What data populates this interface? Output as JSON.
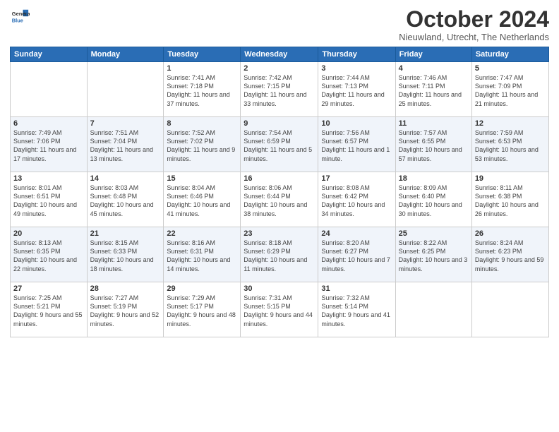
{
  "header": {
    "logo_general": "General",
    "logo_blue": "Blue",
    "title": "October 2024",
    "location": "Nieuwland, Utrecht, The Netherlands"
  },
  "days_of_week": [
    "Sunday",
    "Monday",
    "Tuesday",
    "Wednesday",
    "Thursday",
    "Friday",
    "Saturday"
  ],
  "weeks": [
    [
      {
        "day": "",
        "info": ""
      },
      {
        "day": "",
        "info": ""
      },
      {
        "day": "1",
        "info": "Sunrise: 7:41 AM\nSunset: 7:18 PM\nDaylight: 11 hours and 37 minutes."
      },
      {
        "day": "2",
        "info": "Sunrise: 7:42 AM\nSunset: 7:15 PM\nDaylight: 11 hours and 33 minutes."
      },
      {
        "day": "3",
        "info": "Sunrise: 7:44 AM\nSunset: 7:13 PM\nDaylight: 11 hours and 29 minutes."
      },
      {
        "day": "4",
        "info": "Sunrise: 7:46 AM\nSunset: 7:11 PM\nDaylight: 11 hours and 25 minutes."
      },
      {
        "day": "5",
        "info": "Sunrise: 7:47 AM\nSunset: 7:09 PM\nDaylight: 11 hours and 21 minutes."
      }
    ],
    [
      {
        "day": "6",
        "info": "Sunrise: 7:49 AM\nSunset: 7:06 PM\nDaylight: 11 hours and 17 minutes."
      },
      {
        "day": "7",
        "info": "Sunrise: 7:51 AM\nSunset: 7:04 PM\nDaylight: 11 hours and 13 minutes."
      },
      {
        "day": "8",
        "info": "Sunrise: 7:52 AM\nSunset: 7:02 PM\nDaylight: 11 hours and 9 minutes."
      },
      {
        "day": "9",
        "info": "Sunrise: 7:54 AM\nSunset: 6:59 PM\nDaylight: 11 hours and 5 minutes."
      },
      {
        "day": "10",
        "info": "Sunrise: 7:56 AM\nSunset: 6:57 PM\nDaylight: 11 hours and 1 minute."
      },
      {
        "day": "11",
        "info": "Sunrise: 7:57 AM\nSunset: 6:55 PM\nDaylight: 10 hours and 57 minutes."
      },
      {
        "day": "12",
        "info": "Sunrise: 7:59 AM\nSunset: 6:53 PM\nDaylight: 10 hours and 53 minutes."
      }
    ],
    [
      {
        "day": "13",
        "info": "Sunrise: 8:01 AM\nSunset: 6:51 PM\nDaylight: 10 hours and 49 minutes."
      },
      {
        "day": "14",
        "info": "Sunrise: 8:03 AM\nSunset: 6:48 PM\nDaylight: 10 hours and 45 minutes."
      },
      {
        "day": "15",
        "info": "Sunrise: 8:04 AM\nSunset: 6:46 PM\nDaylight: 10 hours and 41 minutes."
      },
      {
        "day": "16",
        "info": "Sunrise: 8:06 AM\nSunset: 6:44 PM\nDaylight: 10 hours and 38 minutes."
      },
      {
        "day": "17",
        "info": "Sunrise: 8:08 AM\nSunset: 6:42 PM\nDaylight: 10 hours and 34 minutes."
      },
      {
        "day": "18",
        "info": "Sunrise: 8:09 AM\nSunset: 6:40 PM\nDaylight: 10 hours and 30 minutes."
      },
      {
        "day": "19",
        "info": "Sunrise: 8:11 AM\nSunset: 6:38 PM\nDaylight: 10 hours and 26 minutes."
      }
    ],
    [
      {
        "day": "20",
        "info": "Sunrise: 8:13 AM\nSunset: 6:35 PM\nDaylight: 10 hours and 22 minutes."
      },
      {
        "day": "21",
        "info": "Sunrise: 8:15 AM\nSunset: 6:33 PM\nDaylight: 10 hours and 18 minutes."
      },
      {
        "day": "22",
        "info": "Sunrise: 8:16 AM\nSunset: 6:31 PM\nDaylight: 10 hours and 14 minutes."
      },
      {
        "day": "23",
        "info": "Sunrise: 8:18 AM\nSunset: 6:29 PM\nDaylight: 10 hours and 11 minutes."
      },
      {
        "day": "24",
        "info": "Sunrise: 8:20 AM\nSunset: 6:27 PM\nDaylight: 10 hours and 7 minutes."
      },
      {
        "day": "25",
        "info": "Sunrise: 8:22 AM\nSunset: 6:25 PM\nDaylight: 10 hours and 3 minutes."
      },
      {
        "day": "26",
        "info": "Sunrise: 8:24 AM\nSunset: 6:23 PM\nDaylight: 9 hours and 59 minutes."
      }
    ],
    [
      {
        "day": "27",
        "info": "Sunrise: 7:25 AM\nSunset: 5:21 PM\nDaylight: 9 hours and 55 minutes."
      },
      {
        "day": "28",
        "info": "Sunrise: 7:27 AM\nSunset: 5:19 PM\nDaylight: 9 hours and 52 minutes."
      },
      {
        "day": "29",
        "info": "Sunrise: 7:29 AM\nSunset: 5:17 PM\nDaylight: 9 hours and 48 minutes."
      },
      {
        "day": "30",
        "info": "Sunrise: 7:31 AM\nSunset: 5:15 PM\nDaylight: 9 hours and 44 minutes."
      },
      {
        "day": "31",
        "info": "Sunrise: 7:32 AM\nSunset: 5:14 PM\nDaylight: 9 hours and 41 minutes."
      },
      {
        "day": "",
        "info": ""
      },
      {
        "day": "",
        "info": ""
      }
    ]
  ]
}
